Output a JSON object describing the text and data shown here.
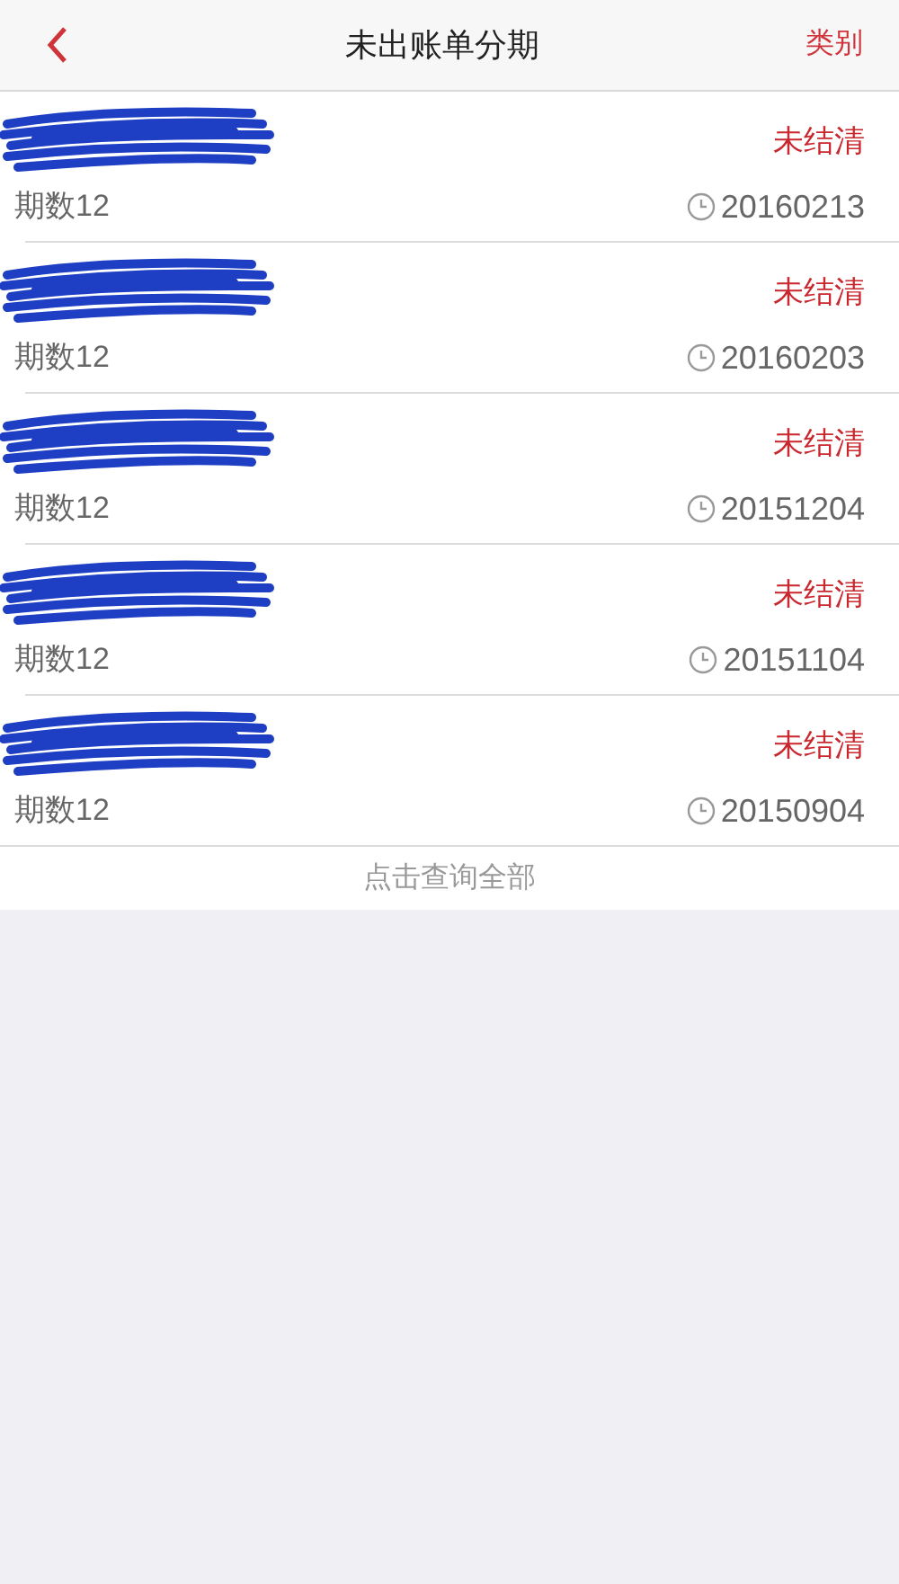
{
  "header": {
    "title": "未出账单分期",
    "action": "类别"
  },
  "rows": [
    {
      "redacted": true,
      "status": "未结清",
      "term": "期数12",
      "date": "20160213"
    },
    {
      "redacted": true,
      "status": "未结清",
      "term": "期数12",
      "date": "20160203"
    },
    {
      "redacted": true,
      "status": "未结清",
      "term": "期数12",
      "date": "20151204"
    },
    {
      "redacted": true,
      "status": "未结清",
      "term": "期数12",
      "date": "20151104"
    },
    {
      "redacted": true,
      "status": "未结清",
      "term": "期数12",
      "date": "20150904"
    }
  ],
  "footer": {
    "label": "点击查询全部"
  }
}
